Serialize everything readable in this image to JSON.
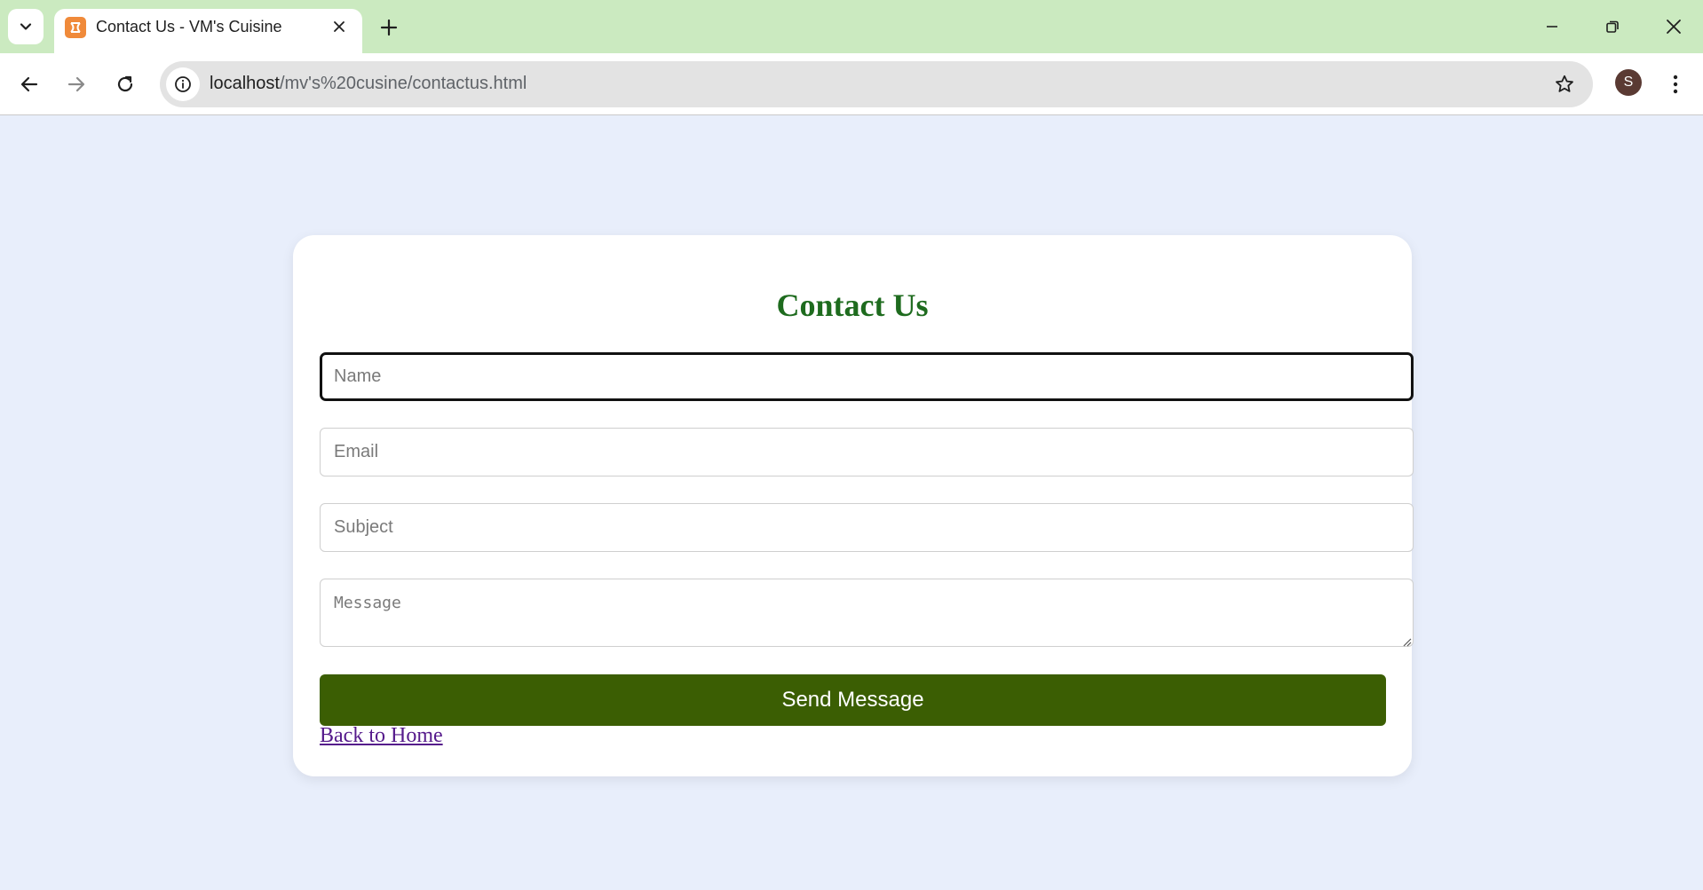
{
  "browser": {
    "tab": {
      "title": "Contact Us - VM's Cuisine",
      "favicon": "xampp-icon"
    },
    "address": {
      "host": "localhost",
      "path": "/mv's%20cusine/contactus.html"
    },
    "profile_initial": "S",
    "colors": {
      "tabstrip": "#cbeac0",
      "avatar": "#5a3a33"
    }
  },
  "page": {
    "title": "Contact Us",
    "form": {
      "name_placeholder": "Name",
      "email_placeholder": "Email",
      "subject_placeholder": "Subject",
      "message_placeholder": "Message",
      "submit_label": "Send Message"
    },
    "back_link": "Back to Home",
    "colors": {
      "background": "#e8eefb",
      "title": "#1e6b1e",
      "button": "#3b5e03",
      "link": "#551a8b"
    }
  }
}
